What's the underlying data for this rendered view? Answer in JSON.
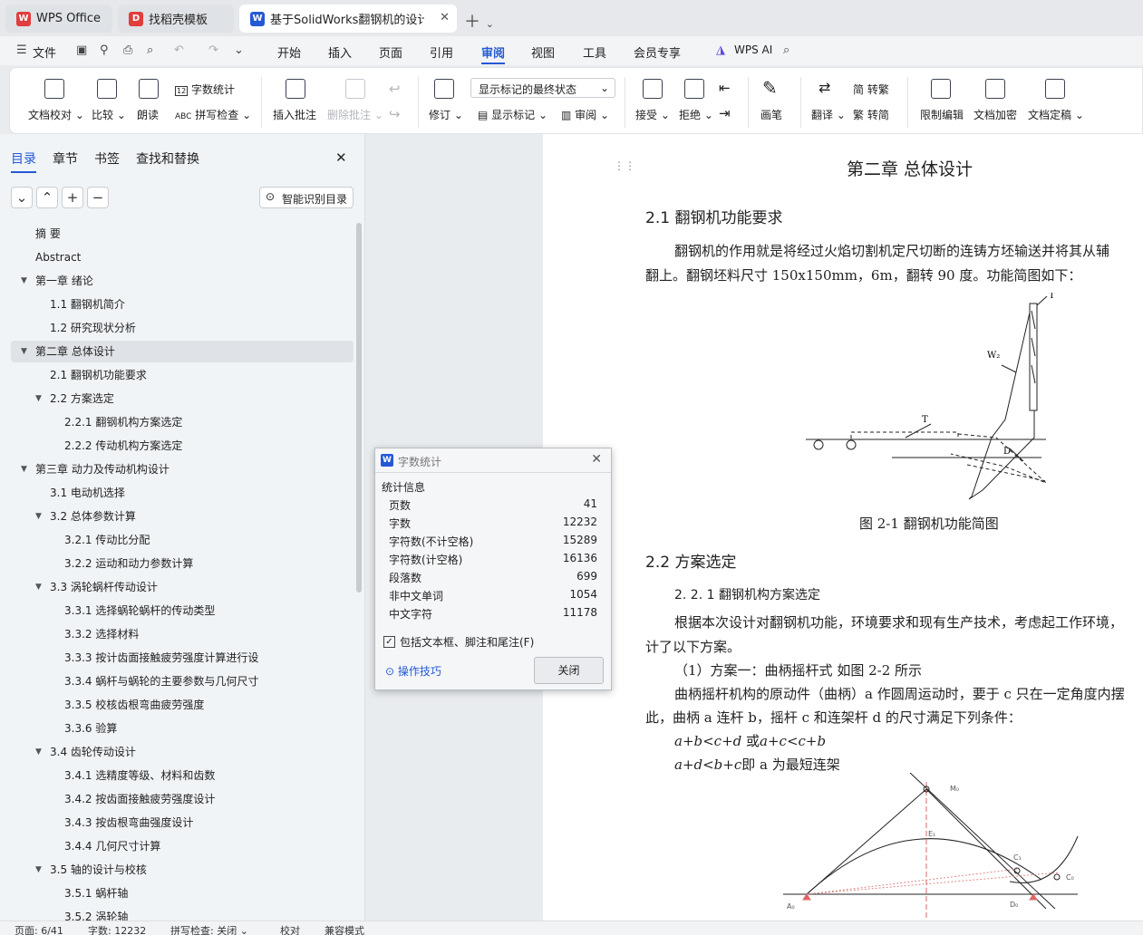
{
  "tabs": [
    {
      "label": "WPS Office",
      "logo": "W",
      "color": "#e23d3d"
    },
    {
      "label": "找稻壳模板",
      "logo": "D",
      "color": "#e23d3d"
    },
    {
      "label": "基于SolidWorks翻钢机的设计",
      "logo": "W",
      "color": "#2459d6"
    }
  ],
  "menu": {
    "file": "文件",
    "items": [
      "开始",
      "插入",
      "页面",
      "引用",
      "审阅",
      "视图",
      "工具",
      "会员专享"
    ],
    "active": "审阅",
    "ai": "WPS AI"
  },
  "ribbon": {
    "doc_check": "文档校对",
    "compare": "比较",
    "read_aloud": "朗读",
    "word_count": "字数统计",
    "spell_check": "拼写检查",
    "insert_comment": "插入批注",
    "delete_comment": "删除批注",
    "revise": "修订",
    "markup_state": "显示标记的最终状态",
    "show_markup": "显示标记",
    "review": "审阅",
    "accept": "接受",
    "reject": "拒绝",
    "pen": "画笔",
    "translate": "翻译",
    "to_traditional": "转繁",
    "to_simplified": "转简",
    "restrict_edit": "限制编辑",
    "doc_encrypt": "文档加密",
    "doc_finalize": "文档定稿"
  },
  "nav": {
    "tabs": [
      "目录",
      "章节",
      "书签",
      "查找和替换"
    ],
    "smart": "智能识别目录",
    "toc": [
      {
        "label": "摘 要",
        "level": 1,
        "arrow": false
      },
      {
        "label": "Abstract",
        "level": 1,
        "arrow": false
      },
      {
        "label": "第一章 绪论",
        "level": 1,
        "arrow": true
      },
      {
        "label": "1.1 翻钢机简介",
        "level": 2,
        "arrow": false
      },
      {
        "label": "1.2 研究现状分析",
        "level": 2,
        "arrow": false
      },
      {
        "label": "第二章 总体设计",
        "level": 1,
        "arrow": true,
        "selected": true
      },
      {
        "label": "2.1 翻钢机功能要求",
        "level": 2,
        "arrow": false
      },
      {
        "label": "2.2 方案选定",
        "level": 2,
        "arrow": true
      },
      {
        "label": "2.2.1 翻钢机构方案选定",
        "level": 3,
        "arrow": false
      },
      {
        "label": "2.2.2 传动机构方案选定",
        "level": 3,
        "arrow": false
      },
      {
        "label": "第三章 动力及传动机构设计",
        "level": 1,
        "arrow": true
      },
      {
        "label": "3.1 电动机选择",
        "level": 2,
        "arrow": false
      },
      {
        "label": "3.2 总体参数计算",
        "level": 2,
        "arrow": true
      },
      {
        "label": "3.2.1 传动比分配",
        "level": 3,
        "arrow": false
      },
      {
        "label": "3.2.2 运动和动力参数计算",
        "level": 3,
        "arrow": false
      },
      {
        "label": "3.3 涡轮蜗杆传动设计",
        "level": 2,
        "arrow": true
      },
      {
        "label": "3.3.1 选择蜗轮蜗杆的传动类型",
        "level": 3,
        "arrow": false
      },
      {
        "label": "3.3.2 选择材料",
        "level": 3,
        "arrow": false
      },
      {
        "label": "3.3.3 按计齿面接触疲劳强度计算进行设",
        "level": 3,
        "arrow": false
      },
      {
        "label": "3.3.4 蜗杆与蜗轮的主要参数与几何尺寸",
        "level": 3,
        "arrow": false
      },
      {
        "label": "3.3.5 校核齿根弯曲疲劳强度",
        "level": 3,
        "arrow": false
      },
      {
        "label": "3.3.6 验算",
        "level": 3,
        "arrow": false
      },
      {
        "label": "3.4 齿轮传动设计",
        "level": 2,
        "arrow": true
      },
      {
        "label": "3.4.1 选精度等级、材料和齿数",
        "level": 3,
        "arrow": false
      },
      {
        "label": "3.4.2 按齿面接触疲劳强度设计",
        "level": 3,
        "arrow": false
      },
      {
        "label": "3.4.3 按齿根弯曲强度设计",
        "level": 3,
        "arrow": false
      },
      {
        "label": "3.4.4 几何尺寸计算",
        "level": 3,
        "arrow": false
      },
      {
        "label": "3.5 轴的设计与校核",
        "level": 2,
        "arrow": true
      },
      {
        "label": "3.5.1 蜗杆轴",
        "level": 3,
        "arrow": false
      },
      {
        "label": "3.5.2 涡轮轴",
        "level": 3,
        "arrow": false
      }
    ]
  },
  "doc": {
    "chapter_title": "第二章 总体设计",
    "h21": "2.1 翻钢机功能要求",
    "p1a": "翻钢机的作用就是将经过火焰切割机定尺切断的连铸方坯输送并将其从辅",
    "p1b": "翻上。翻钢坯料尺寸 150x150mm，6m，翻转 90 度。功能简图如下：",
    "fig1_caption": "图 2-1  翻钢机功能简图",
    "fig1_labels": {
      "t1": "T",
      "w": "W₂",
      "t2": "T",
      "d": "D"
    },
    "h22": "2.2 方案选定",
    "h221": "2. 2. 1 翻钢机构方案选定",
    "p2a": "根据本次设计对翻钢机功能，环境要求和现有生产技术，考虑起工作环境，",
    "p2b": "计了以下方案。",
    "p3": "（1）方案一：曲柄摇杆式  如图 2-2 所示",
    "p4a": "曲柄摇杆机构的原动件（曲柄）a 作圆周运动时，要于 c 只在一定角度内摆",
    "p4b": "此，曲柄 a 连杆 b，摇杆 c 和连架杆 d 的尺寸满足下列条件：",
    "f1a": "a+b<c+d",
    "f1m": " 或",
    "f1b": "a+c<c+b",
    "f2a": "a+d<b+c",
    "f2b": "即 a 为最短连架",
    "fig2_labels": {
      "m": "M₀",
      "e": "E₁",
      "c1": "C₁",
      "c0": "C₀",
      "a0": "A₀",
      "d0": "D₀"
    }
  },
  "dialog": {
    "title": "字数统计",
    "section": "统计信息",
    "rows": [
      {
        "label": "页数",
        "value": "41"
      },
      {
        "label": "字数",
        "value": "12232"
      },
      {
        "label": "字符数(不计空格)",
        "value": "15289"
      },
      {
        "label": "字符数(计空格)",
        "value": "16136"
      },
      {
        "label": "段落数",
        "value": "699"
      },
      {
        "label": "非中文单词",
        "value": "1054"
      },
      {
        "label": "中文字符",
        "value": "11178"
      }
    ],
    "checkbox": "包括文本框、脚注和尾注(F)",
    "tips": "操作技巧",
    "close": "关闭"
  },
  "status": {
    "page": "页面: 6/41",
    "words": "字数: 12232",
    "spell": "拼写检查: 关闭",
    "proof": "校对",
    "compat": "兼容模式"
  },
  "colors": {
    "accent": "#2459d6",
    "wps_red": "#e23d3d"
  }
}
